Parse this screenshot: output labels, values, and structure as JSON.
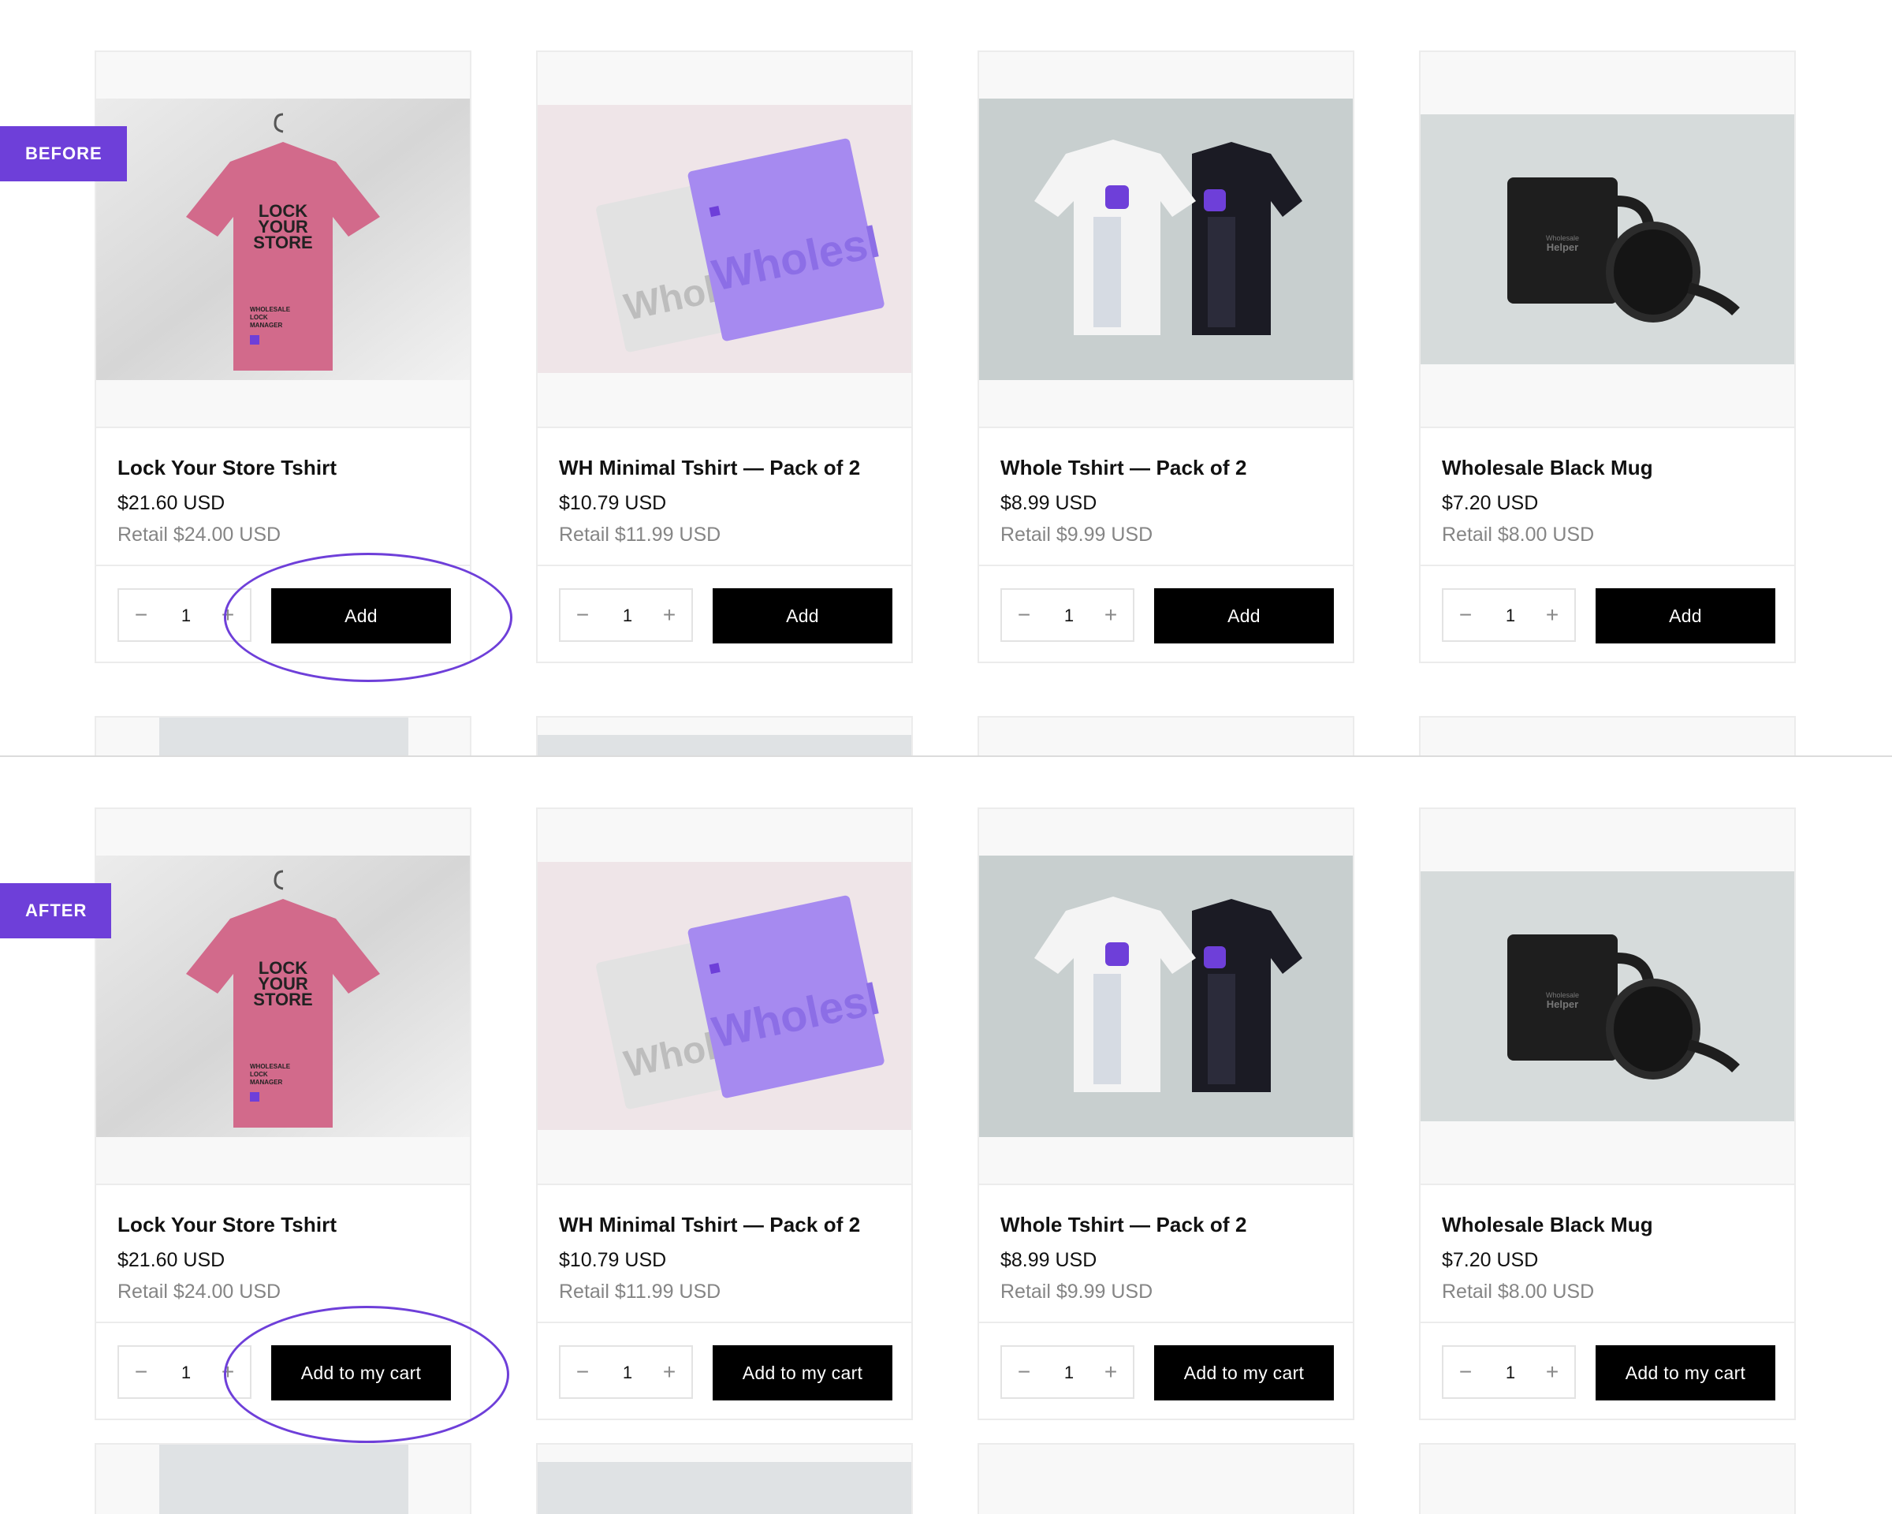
{
  "sections": [
    {
      "id": "before",
      "badge": "BEFORE",
      "products": [
        {
          "title": "Lock Your Store Tshirt",
          "price": "$21.60 USD",
          "retail": "Retail $24.00 USD",
          "qty": "1",
          "button": "Add",
          "image": "pink-tshirt-image"
        },
        {
          "title": "WH Minimal Tshirt — Pack of 2",
          "price": "$10.79 USD",
          "retail": "Retail $11.99 USD",
          "qty": "1",
          "button": "Add",
          "image": "folded-tshirts-image"
        },
        {
          "title": "Whole Tshirt — Pack of 2",
          "price": "$8.99 USD",
          "retail": "Retail $9.99 USD",
          "qty": "1",
          "button": "Add",
          "image": "white-black-tshirts-image"
        },
        {
          "title": "Wholesale Black Mug",
          "price": "$7.20 USD",
          "retail": "Retail $8.00 USD",
          "qty": "1",
          "button": "Add",
          "image": "black-mug-image"
        }
      ]
    },
    {
      "id": "after",
      "badge": "AFTER",
      "products": [
        {
          "title": "Lock Your Store Tshirt",
          "price": "$21.60 USD",
          "retail": "Retail $24.00 USD",
          "qty": "1",
          "button": "Add to my cart",
          "image": "pink-tshirt-image"
        },
        {
          "title": "WH Minimal Tshirt — Pack of 2",
          "price": "$10.79 USD",
          "retail": "Retail $11.99 USD",
          "qty": "1",
          "button": "Add to my cart",
          "image": "folded-tshirts-image"
        },
        {
          "title": "Whole Tshirt — Pack of 2",
          "price": "$8.99 USD",
          "retail": "Retail $9.99 USD",
          "qty": "1",
          "button": "Add to my cart",
          "image": "white-black-tshirts-image"
        },
        {
          "title": "Wholesale Black Mug",
          "price": "$7.20 USD",
          "retail": "Retail $8.00 USD",
          "qty": "1",
          "button": "Add to my cart",
          "image": "black-mug-image"
        }
      ]
    }
  ],
  "image_text": {
    "tshirt_print": [
      "LOCK",
      "YOUR",
      "STORE"
    ],
    "tshirt_sub": [
      "WHOLESALE",
      "LOCK",
      "MANAGER"
    ],
    "folded_print": "Wholesl",
    "mug_print": [
      "Wholesale",
      "Helper"
    ]
  },
  "qty_controls": {
    "minus": "−",
    "plus": "+"
  },
  "colors": {
    "accent": "#6e3fd9",
    "button": "#000000",
    "retail_text": "#858585"
  }
}
